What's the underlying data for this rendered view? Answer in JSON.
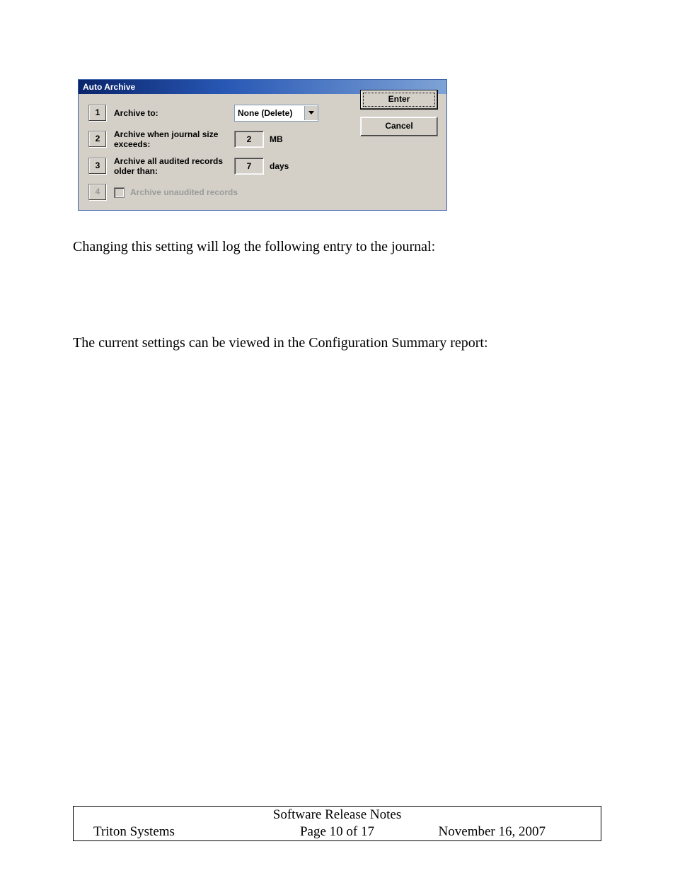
{
  "dialog": {
    "title": "Auto Archive",
    "rows": [
      {
        "num": "1",
        "label": "Archive to:"
      },
      {
        "num": "2",
        "label": "Archive when journal size exceeds:"
      },
      {
        "num": "3",
        "label": "Archive all audited records older than:"
      },
      {
        "num": "4",
        "label": "Archive unaudited records"
      }
    ],
    "comboValue": "None (Delete)",
    "sizeValue": "2",
    "sizeUnit": "MB",
    "daysValue": "7",
    "daysUnit": "days",
    "enterLabel": "Enter",
    "cancelLabel": "Cancel"
  },
  "para1": "Changing this setting will log the following entry to the journal:",
  "para2": "The current settings can be viewed in the Configuration Summary report:",
  "footer": {
    "title": "Software Release Notes",
    "left": "Triton Systems",
    "page": "Page 10 of 17",
    "date": "November 16, 2007"
  }
}
